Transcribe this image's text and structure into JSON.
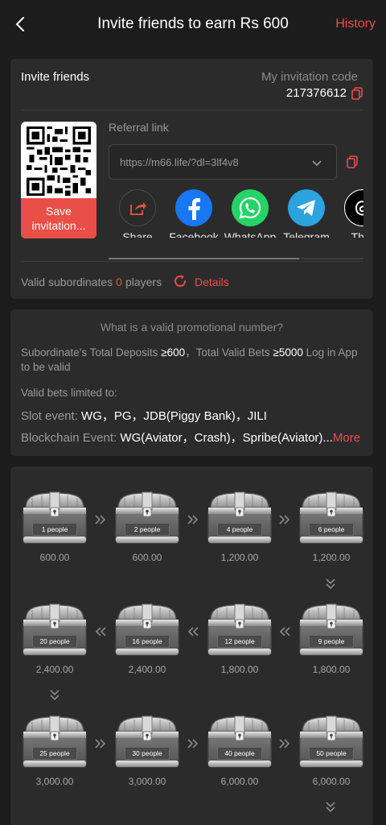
{
  "header": {
    "title": "Invite friends to earn Rs 600",
    "history_label": "History"
  },
  "invite": {
    "label": "Invite friends",
    "code_label": "My invitation code",
    "code_value": "217376612",
    "save_label": "Save invitation...",
    "referral_label": "Referral link",
    "referral_link": "https://m66.life/?dl=3lf4v8",
    "share_items": [
      {
        "label": "Share",
        "icon": "share-icon",
        "color": "#2a2a2a"
      },
      {
        "label": "Facebook",
        "icon": "facebook-icon",
        "color": "#1877f2"
      },
      {
        "label": "WhatsApp",
        "icon": "whatsapp-icon",
        "color": "#25d366"
      },
      {
        "label": "Telegram",
        "icon": "telegram-icon",
        "color": "#2aa3df"
      },
      {
        "label": "Thre",
        "icon": "threads-icon",
        "color": "#000000"
      }
    ],
    "valid_label": "Valid subordinates",
    "valid_count": "0",
    "valid_unit": "players",
    "details_label": "Details"
  },
  "promo": {
    "title": "What is a valid promotional number?",
    "desc_part1": "Subordinate's Total Deposits ",
    "desc_dep": "≥600",
    "desc_part2": "，Total Valid Bets ",
    "desc_bets": "≥5000",
    "desc_part3": " Log in App to be valid",
    "bets_label": "Valid bets limited to:",
    "slot_label": "Slot event: ",
    "slot_value": "WG，PG，JDB(Piggy Bank)，JILI",
    "chain_label": "Blockchain Event: ",
    "chain_value": "WG(Aviator，Crash)，Spribe(Aviator)...",
    "more_label": "More"
  },
  "rewards": [
    {
      "people": "1 people",
      "amount": "600.00"
    },
    {
      "people": "2 people",
      "amount": "600.00"
    },
    {
      "people": "4 people",
      "amount": "1,200.00"
    },
    {
      "people": "6 people",
      "amount": "1,200.00"
    },
    {
      "people": "9 people",
      "amount": "1,800.00"
    },
    {
      "people": "12 people",
      "amount": "1,800.00"
    },
    {
      "people": "16 people",
      "amount": "2,400.00"
    },
    {
      "people": "20 people",
      "amount": "2,400.00"
    },
    {
      "people": "25 people",
      "amount": "3,000.00"
    },
    {
      "people": "30 people",
      "amount": "3,000.00"
    },
    {
      "people": "40 people",
      "amount": "6,000.00"
    },
    {
      "people": "50 people",
      "amount": "6,000.00"
    }
  ],
  "colors": {
    "accent": "#e94e47",
    "background": "#1c1c1c",
    "card": "#2b2b2b"
  }
}
